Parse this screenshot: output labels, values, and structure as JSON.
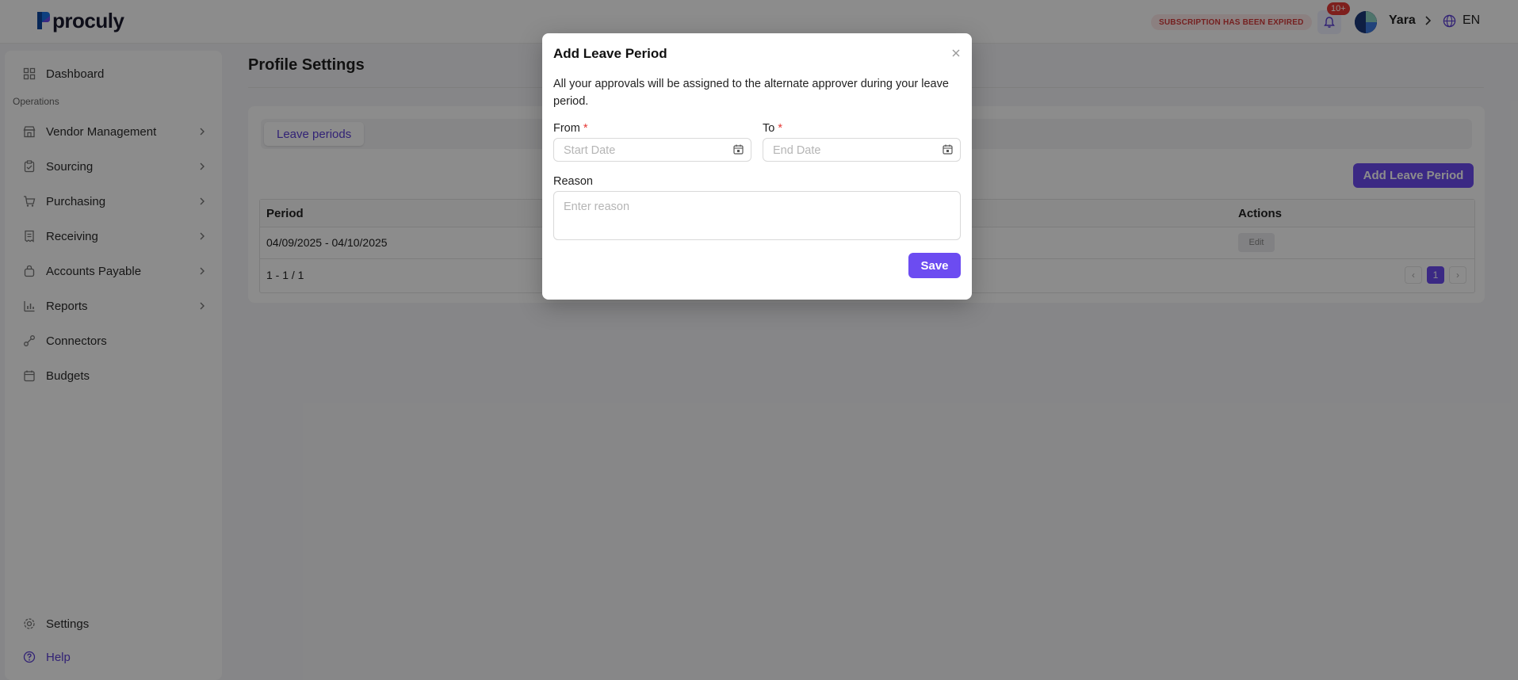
{
  "header": {
    "logo_text": "proculy",
    "subscription_notice": "SUBSCRIPTION HAS BEEN EXPIRED",
    "notification_count": "10+",
    "user_name": "Yara",
    "language": "EN"
  },
  "sidebar": {
    "top_item": "Dashboard",
    "section_label": "Operations",
    "items": [
      {
        "label": "Vendor Management",
        "icon": "store-icon",
        "has_submenu": true
      },
      {
        "label": "Sourcing",
        "icon": "clipboard-icon",
        "has_submenu": true
      },
      {
        "label": "Purchasing",
        "icon": "cart-icon",
        "has_submenu": true
      },
      {
        "label": "Receiving",
        "icon": "receipt-icon",
        "has_submenu": true
      },
      {
        "label": "Accounts Payable",
        "icon": "bag-icon",
        "has_submenu": true
      },
      {
        "label": "Reports",
        "icon": "chart-icon",
        "has_submenu": true
      },
      {
        "label": "Connectors",
        "icon": "plug-icon",
        "has_submenu": false
      },
      {
        "label": "Budgets",
        "icon": "calendar-icon",
        "has_submenu": false
      }
    ],
    "settings": "Settings",
    "help": "Help"
  },
  "main": {
    "page_title": "Profile Settings",
    "tab_active": "Leave periods",
    "add_button": "Add Leave Period",
    "table": {
      "headers": [
        "Period",
        "Actions"
      ],
      "rows": [
        {
          "period": "04/09/2025 - 04/10/2025",
          "action": "Edit"
        }
      ]
    },
    "range_text": "1 - 1 / 1",
    "pagination": {
      "prev": "‹",
      "current": "1",
      "next": "›"
    }
  },
  "modal": {
    "title": "Add Leave Period",
    "description": "All your approvals will be assigned to the alternate approver during your leave period.",
    "from_label": "From",
    "from_placeholder": "Start Date",
    "to_label": "To",
    "to_placeholder": "End Date",
    "required_mark": "*",
    "reason_label": "Reason",
    "reason_placeholder": "Enter reason",
    "save_label": "Save"
  },
  "colors": {
    "accent": "#6c4cf1",
    "danger": "#e53935",
    "overlay": "rgba(0,0,0,0.45)"
  }
}
